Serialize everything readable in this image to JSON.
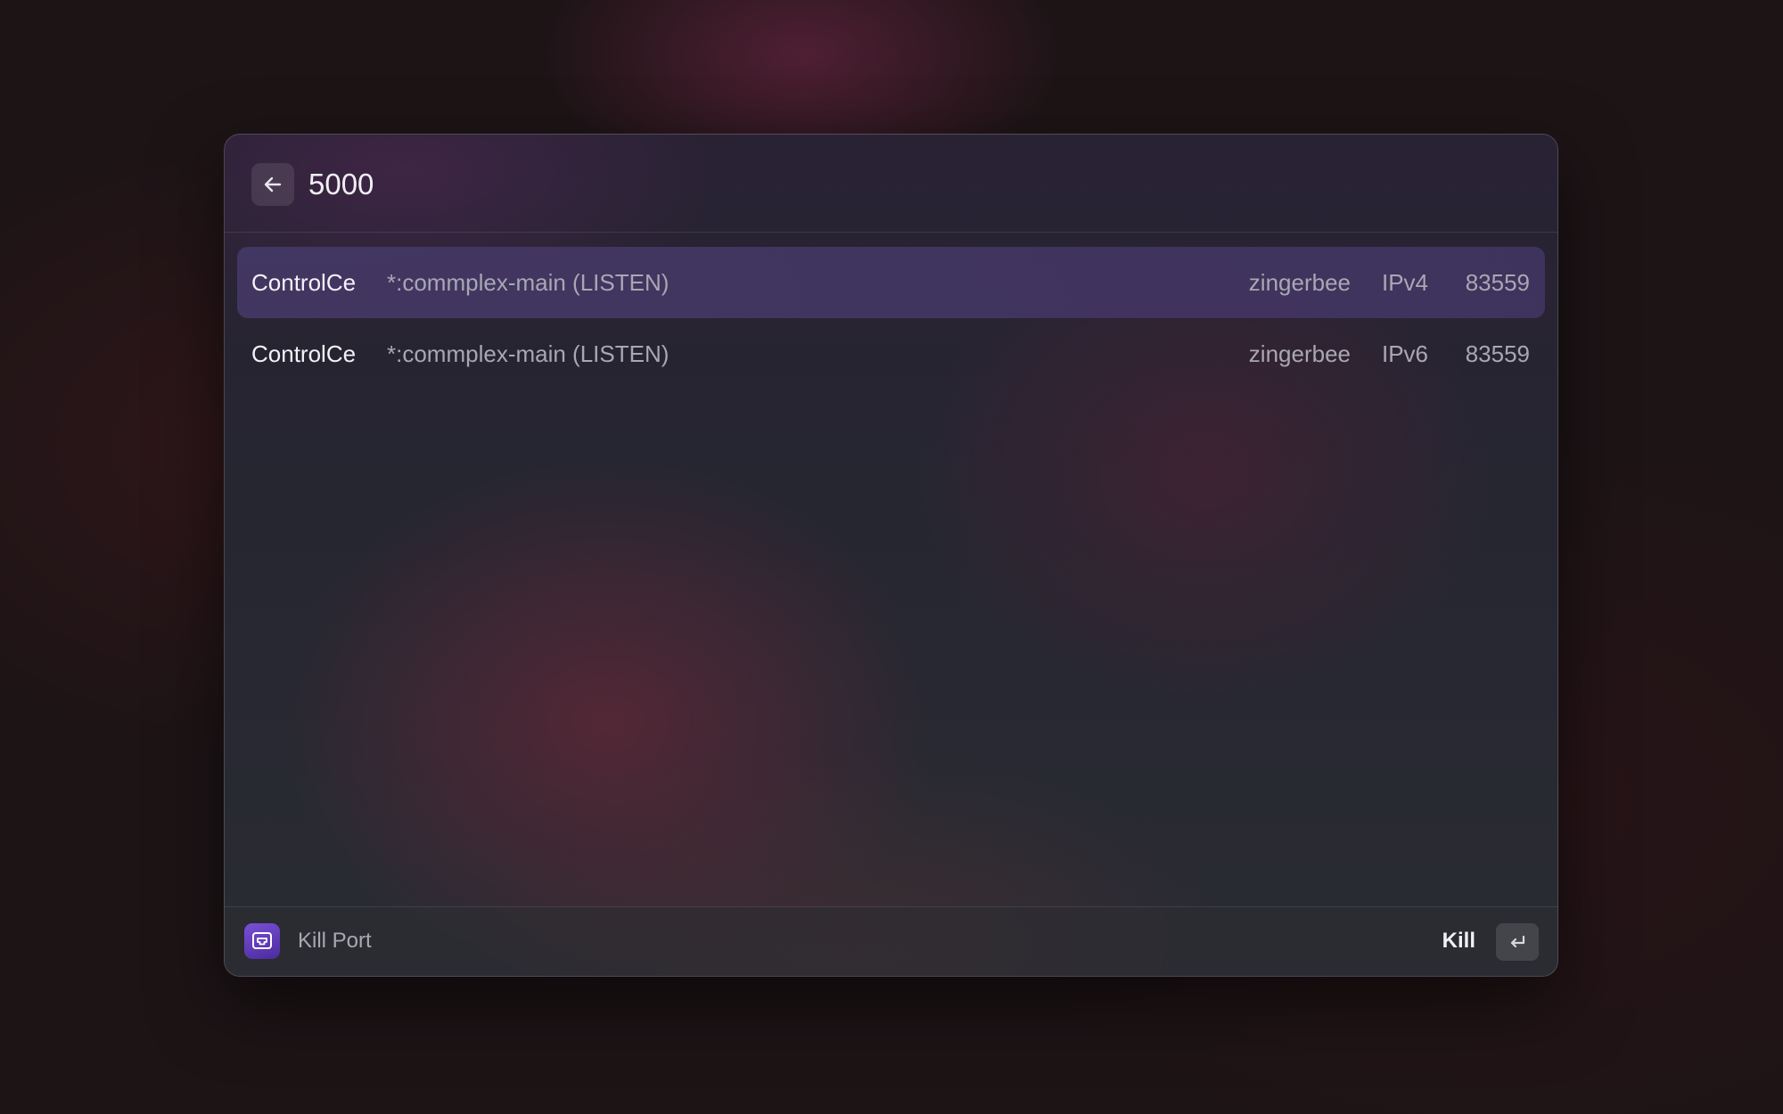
{
  "search": {
    "value": "5000",
    "back_icon": "arrow-left-icon"
  },
  "results": [
    {
      "name": "ControlCe",
      "command": "*:commplex-main (LISTEN)",
      "user": "zingerbee",
      "type": "IPv4",
      "pid": "83559",
      "selected": true
    },
    {
      "name": "ControlCe",
      "command": "*:commplex-main (LISTEN)",
      "user": "zingerbee",
      "type": "IPv6",
      "pid": "83559",
      "selected": false
    }
  ],
  "footer": {
    "app_icon": "ethernet-port-icon",
    "title": "Kill Port",
    "action_label": "Kill",
    "action_key_icon": "return-key-icon"
  },
  "colors": {
    "accent_selected_row": "#463a69",
    "app_icon": "#6a41c6"
  }
}
